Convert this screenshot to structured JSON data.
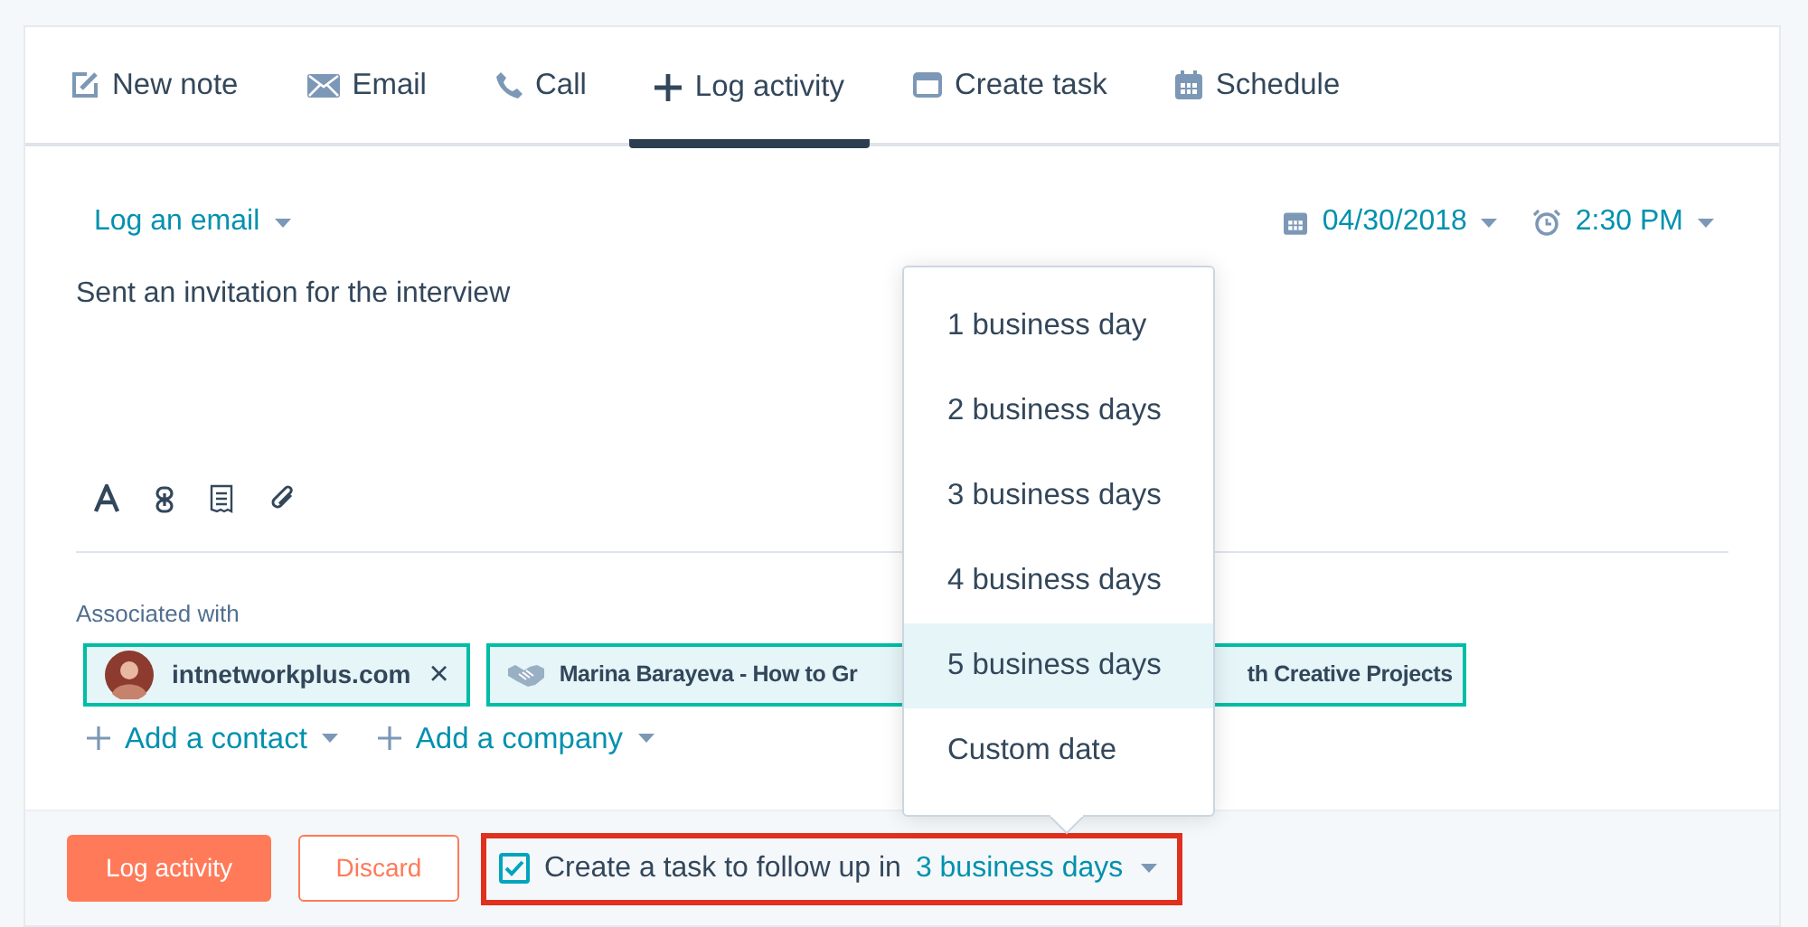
{
  "tabs": [
    {
      "label": "New note",
      "selected": false
    },
    {
      "label": "Email",
      "selected": false
    },
    {
      "label": "Call",
      "selected": false
    },
    {
      "label": "Log activity",
      "selected": true
    },
    {
      "label": "Create task",
      "selected": false
    },
    {
      "label": "Schedule",
      "selected": false
    }
  ],
  "log_type": "Log an email",
  "date": "04/30/2018",
  "time": "2:30 PM",
  "body": "Sent an invitation for the interview",
  "associated_label": "Associated with",
  "associations": [
    {
      "kind": "contact",
      "text": "intnetworkplus.com",
      "remove": "×"
    },
    {
      "kind": "deal",
      "text": "Marina Barayeva - How to Gr",
      "text_after": "th Creative Projects"
    }
  ],
  "add_links": [
    "Add a contact",
    "Add a company"
  ],
  "buttons": {
    "primary": "Log activity",
    "secondary": "Discard"
  },
  "follow_up": {
    "checked": true,
    "label": "Create a task to follow up in",
    "value": "3 business days"
  },
  "dropdown": [
    {
      "label": "1 business day",
      "selected": false
    },
    {
      "label": "2 business days",
      "selected": false
    },
    {
      "label": "3 business days",
      "selected": false
    },
    {
      "label": "4 business days",
      "selected": false
    },
    {
      "label": "5 business days",
      "selected": true
    },
    {
      "label": "Custom date",
      "selected": false
    }
  ]
}
